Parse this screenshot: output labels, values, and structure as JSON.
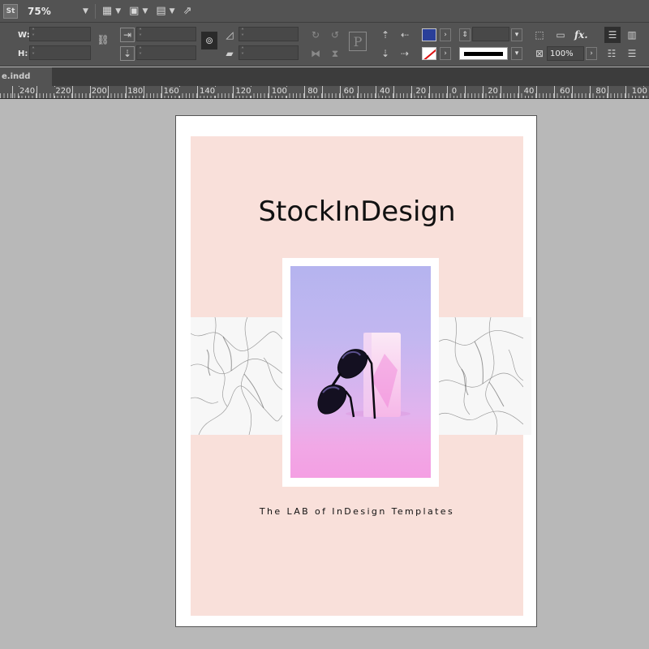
{
  "appbar": {
    "logo": "St",
    "zoom": "75%",
    "icons": [
      "chevron-down-icon",
      "view-options-icon",
      "screen-mode-icon",
      "arrange-documents-icon",
      "publish-icon"
    ]
  },
  "control_panel": {
    "w_label": "W:",
    "h_label": "H:",
    "stroke_weight_value": "",
    "opacity_value": "100%",
    "fx_label": "fx.",
    "p_label": "P",
    "colors": {
      "fill": "#2a3f99",
      "stroke_slash": "#dd1111"
    }
  },
  "tabs": {
    "document": "e.indd"
  },
  "ruler": {
    "labels": [
      "240",
      "220",
      "200",
      "180",
      "160",
      "140",
      "120",
      "100",
      "80",
      "60",
      "40",
      "20",
      "0",
      "20",
      "40",
      "60",
      "80",
      "100"
    ]
  },
  "page": {
    "brand_title": "StockInDesign",
    "tagline": "The LAB of InDesign Templates",
    "colors": {
      "background_block": "#f9e0da",
      "page": "#ffffff"
    }
  }
}
